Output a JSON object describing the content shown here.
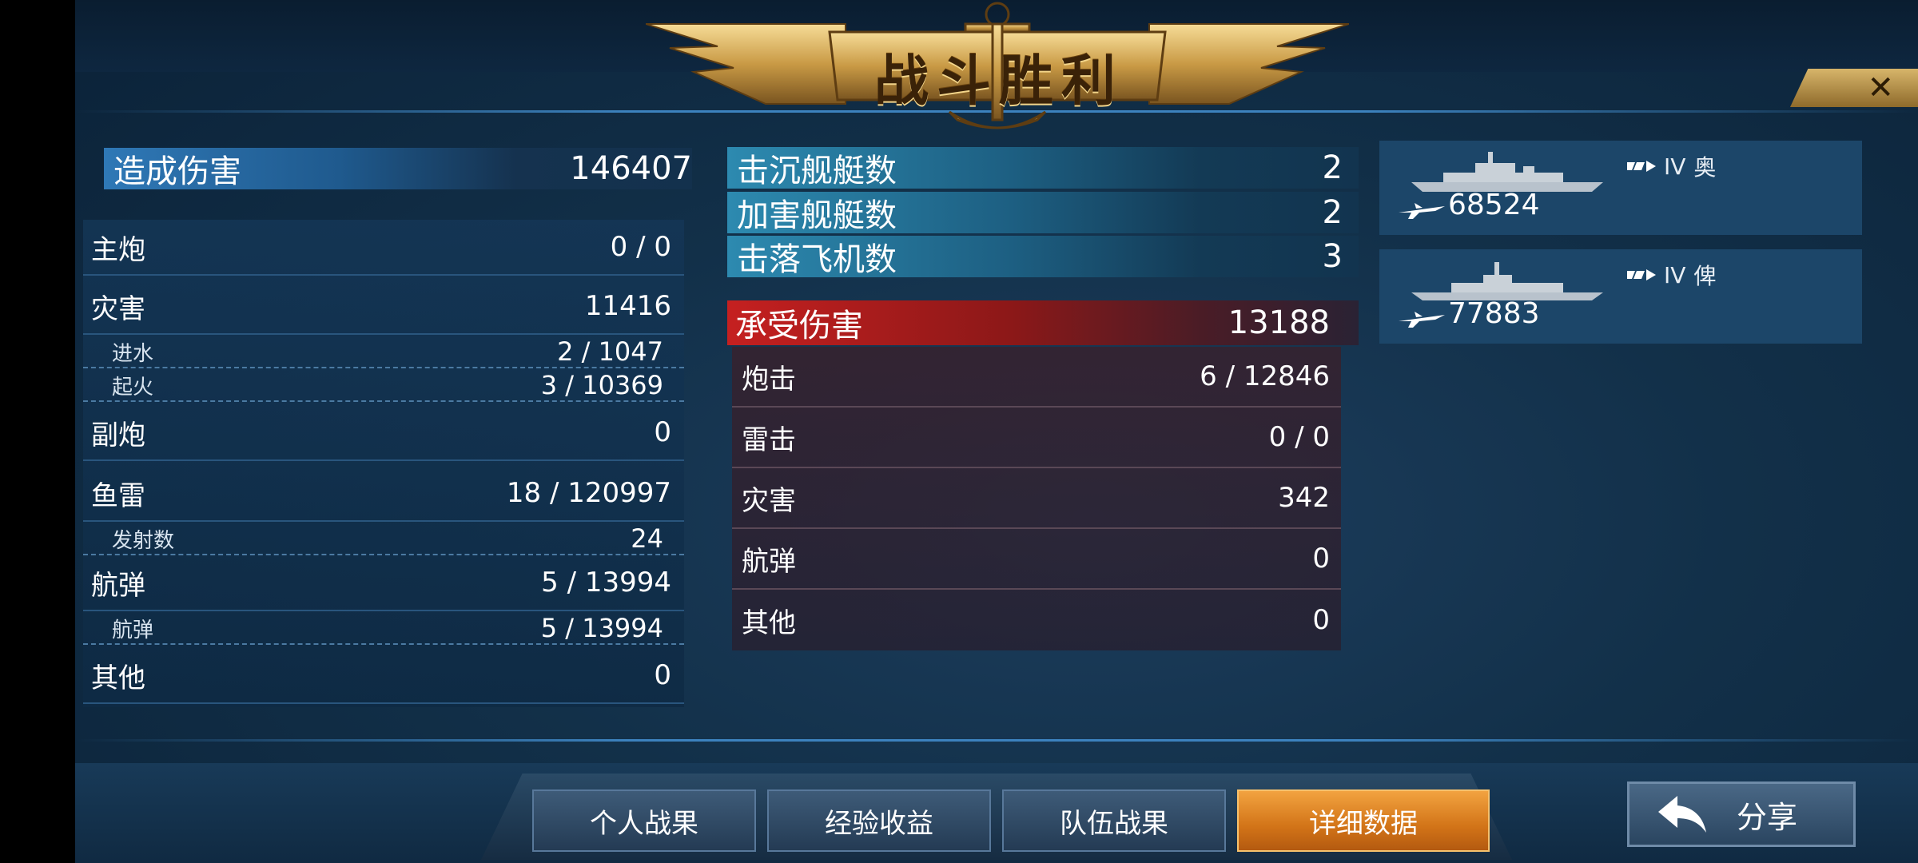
{
  "title": "战斗胜利",
  "close_symbol": "✕",
  "damage_dealt": {
    "label": "造成伤害",
    "value": "146407",
    "rows": [
      {
        "label": "主炮",
        "value": "0 / 0",
        "type": "main"
      },
      {
        "label": "灾害",
        "value": "11416",
        "type": "main"
      },
      {
        "label": "进水",
        "value": "2 / 1047",
        "type": "sub"
      },
      {
        "label": "起火",
        "value": "3 / 10369",
        "type": "sub"
      },
      {
        "label": "副炮",
        "value": "0",
        "type": "main"
      },
      {
        "label": "鱼雷",
        "value": "18 / 120997",
        "type": "main"
      },
      {
        "label": "发射数",
        "value": "24",
        "type": "sub"
      },
      {
        "label": "航弹",
        "value": "5 / 13994",
        "type": "main"
      },
      {
        "label": "航弹",
        "value": "5 / 13994",
        "type": "sub"
      },
      {
        "label": "其他",
        "value": "0",
        "type": "main"
      }
    ]
  },
  "combat_stats": [
    {
      "label": "击沉舰艇数",
      "value": "2"
    },
    {
      "label": "加害舰艇数",
      "value": "2"
    },
    {
      "label": "击落飞机数",
      "value": "3"
    }
  ],
  "damage_received": {
    "label": "承受伤害",
    "value": "13188",
    "rows": [
      {
        "label": "炮击",
        "value": "6 / 12846"
      },
      {
        "label": "雷击",
        "value": "0 / 0"
      },
      {
        "label": "灾害",
        "value": "342"
      },
      {
        "label": "航弹",
        "value": "0"
      },
      {
        "label": "其他",
        "value": "0"
      }
    ]
  },
  "ships": [
    {
      "tier": "IV",
      "name": "奥",
      "damage": "68524",
      "icon": "aircraft-icon"
    },
    {
      "tier": "IV",
      "name": "俾",
      "damage": "77883",
      "icon": "aircraft-icon"
    }
  ],
  "tabs": [
    {
      "label": "个人战果",
      "active": false
    },
    {
      "label": "经验收益",
      "active": false
    },
    {
      "label": "队伍战果",
      "active": false
    },
    {
      "label": "详细数据",
      "active": true
    }
  ],
  "share": {
    "label": "分享",
    "icon": "back-arrow-icon"
  },
  "colors": {
    "accent_gold": "#d4ae5e",
    "active_tab": "#e08a28",
    "received_red": "#c52020",
    "panel_blue": "#1c4669"
  }
}
